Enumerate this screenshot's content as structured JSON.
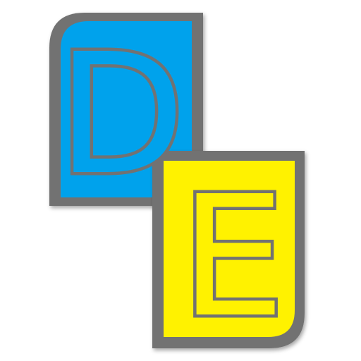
{
  "logo": {
    "letter_top": "D",
    "letter_bottom": "E",
    "colors": {
      "top_tile": "#00a2ec",
      "bottom_tile": "#fff200",
      "outline": "#727272",
      "background": "#ffffff"
    }
  }
}
